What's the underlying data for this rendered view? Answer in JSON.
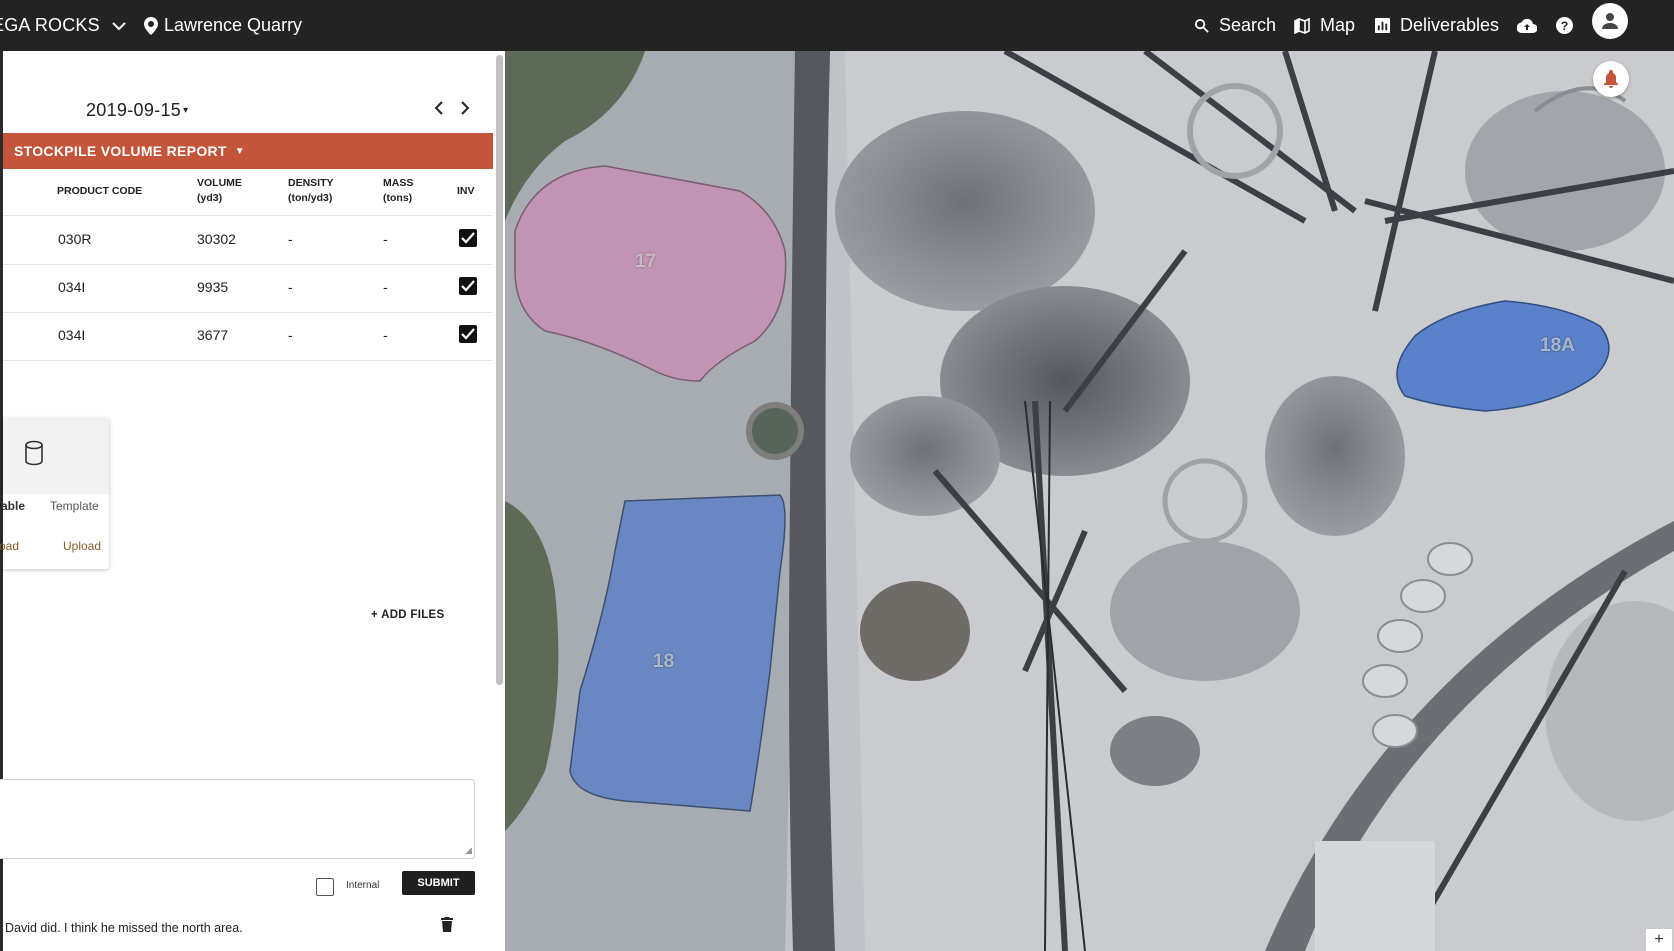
{
  "header": {
    "org_name": "EGA ROCKS",
    "site_name": "Lawrence Quarry",
    "nav": {
      "search": "Search",
      "map": "Map",
      "deliverables": "Deliverables"
    },
    "icons": [
      "chevron-down-icon",
      "location-pin-icon",
      "search-icon",
      "map-icon",
      "chart-icon",
      "cloud-upload-icon",
      "help-icon",
      "account-icon"
    ]
  },
  "panel": {
    "date": "2019-09-15",
    "report_title": "STOCKPILE VOLUME REPORT",
    "report_color": "#c4553b",
    "table": {
      "headers": {
        "product_code": "PRODUCT CODE",
        "volume": "VOLUME",
        "volume_unit": "(yd3)",
        "density": "DENSITY",
        "density_unit": "(ton/yd3)",
        "mass": "MASS",
        "mass_unit": "(tons)",
        "inv": "INV"
      },
      "rows": [
        {
          "product_code": "030R",
          "volume": "30302",
          "density": "-",
          "mass": "-",
          "inv": true
        },
        {
          "product_code": "034I",
          "volume": "9935",
          "density": "-",
          "mass": "-",
          "inv": true
        },
        {
          "product_code": "034I",
          "volume": "3677",
          "density": "-",
          "mass": "-",
          "inv": true
        }
      ]
    },
    "upload_card": {
      "label_1": "able",
      "label_2": "Template",
      "label_3": "oad",
      "label_4": "Upload"
    },
    "add_files": "+ ADD FILES",
    "comment": {
      "placeholder": "",
      "internal_label": "Internal",
      "submit_label": "SUBMIT",
      "existing": "David did. I think he missed the north area."
    }
  },
  "map": {
    "piles": [
      {
        "label": "17",
        "color": "#c98fb4"
      },
      {
        "label": "18",
        "color": "#5b7fc7"
      },
      {
        "label": "18A",
        "color": "#4a78c9"
      }
    ],
    "zoom_in": "+"
  }
}
